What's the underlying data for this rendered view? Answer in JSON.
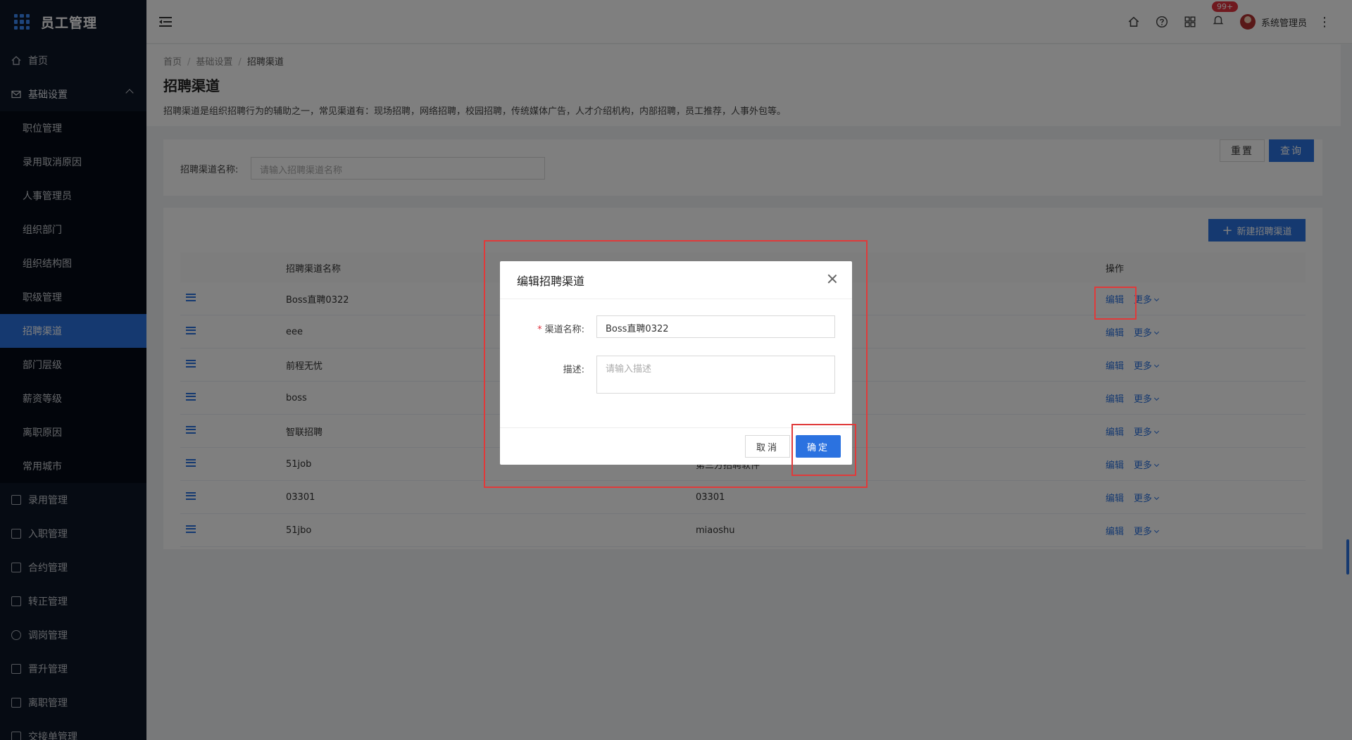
{
  "app": {
    "title": "员工管理"
  },
  "sidebar": {
    "items": [
      {
        "label": "首页",
        "icon": "home-icon"
      },
      {
        "label": "基础设置",
        "icon": "mail-icon",
        "expanded": true
      },
      {
        "label": "录用管理",
        "icon": "doc-icon"
      },
      {
        "label": "入职管理",
        "icon": "file-icon"
      },
      {
        "label": "合约管理",
        "icon": "calendar-icon"
      },
      {
        "label": "转正管理",
        "icon": "grid-icon"
      },
      {
        "label": "调岗管理",
        "icon": "user-icon"
      },
      {
        "label": "晋升管理",
        "icon": "chart-icon"
      },
      {
        "label": "离职管理",
        "icon": "leave-icon"
      },
      {
        "label": "交接单管理",
        "icon": "handover-icon"
      }
    ],
    "submenu": [
      "职位管理",
      "录用取消原因",
      "人事管理员",
      "组织部门",
      "组织结构图",
      "职级管理",
      "招聘渠道",
      "部门层级",
      "薪资等级",
      "离职原因",
      "常用城市"
    ],
    "active_sub": "招聘渠道"
  },
  "header": {
    "notification_count": "99+",
    "username": "系统管理员"
  },
  "page": {
    "breadcrumb": [
      "首页",
      "基础设置",
      "招聘渠道"
    ],
    "title": "招聘渠道",
    "description": "招聘渠道是组织招聘行为的辅助之一，常见渠道有：现场招聘，网络招聘，校园招聘，传统媒体广告，人才介绍机构，内部招聘，员工推荐，人事外包等。"
  },
  "search": {
    "label": "招聘渠道名称:",
    "placeholder": "请输入招聘渠道名称",
    "reset_label": "重置",
    "query_label": "查询"
  },
  "table": {
    "new_button_label": "新建招聘渠道",
    "columns": {
      "name": "招聘渠道名称",
      "description": "",
      "operation": "操作"
    },
    "rows": [
      {
        "name": "Boss直聘0322",
        "description": ""
      },
      {
        "name": "eee",
        "description": ""
      },
      {
        "name": "前程无忧",
        "description": ""
      },
      {
        "name": "boss",
        "description": ""
      },
      {
        "name": "智联招聘",
        "description": ""
      },
      {
        "name": "51job",
        "description": "第三方招聘软件"
      },
      {
        "name": "03301",
        "description": "03301"
      },
      {
        "name": "51jbo",
        "description": "miaoshu"
      }
    ],
    "edit_label": "编辑",
    "more_label": "更多"
  },
  "modal": {
    "title": "编辑招聘渠道",
    "name_label": "渠道名称:",
    "name_value": "Boss直聘0322",
    "desc_label": "描述:",
    "desc_placeholder": "请输入描述",
    "cancel_label": "取消",
    "ok_label": "确定"
  },
  "colors": {
    "primary": "#2b72e0",
    "sidebar_bg": "#0d1626",
    "annotation_red": "#e03a3a"
  }
}
